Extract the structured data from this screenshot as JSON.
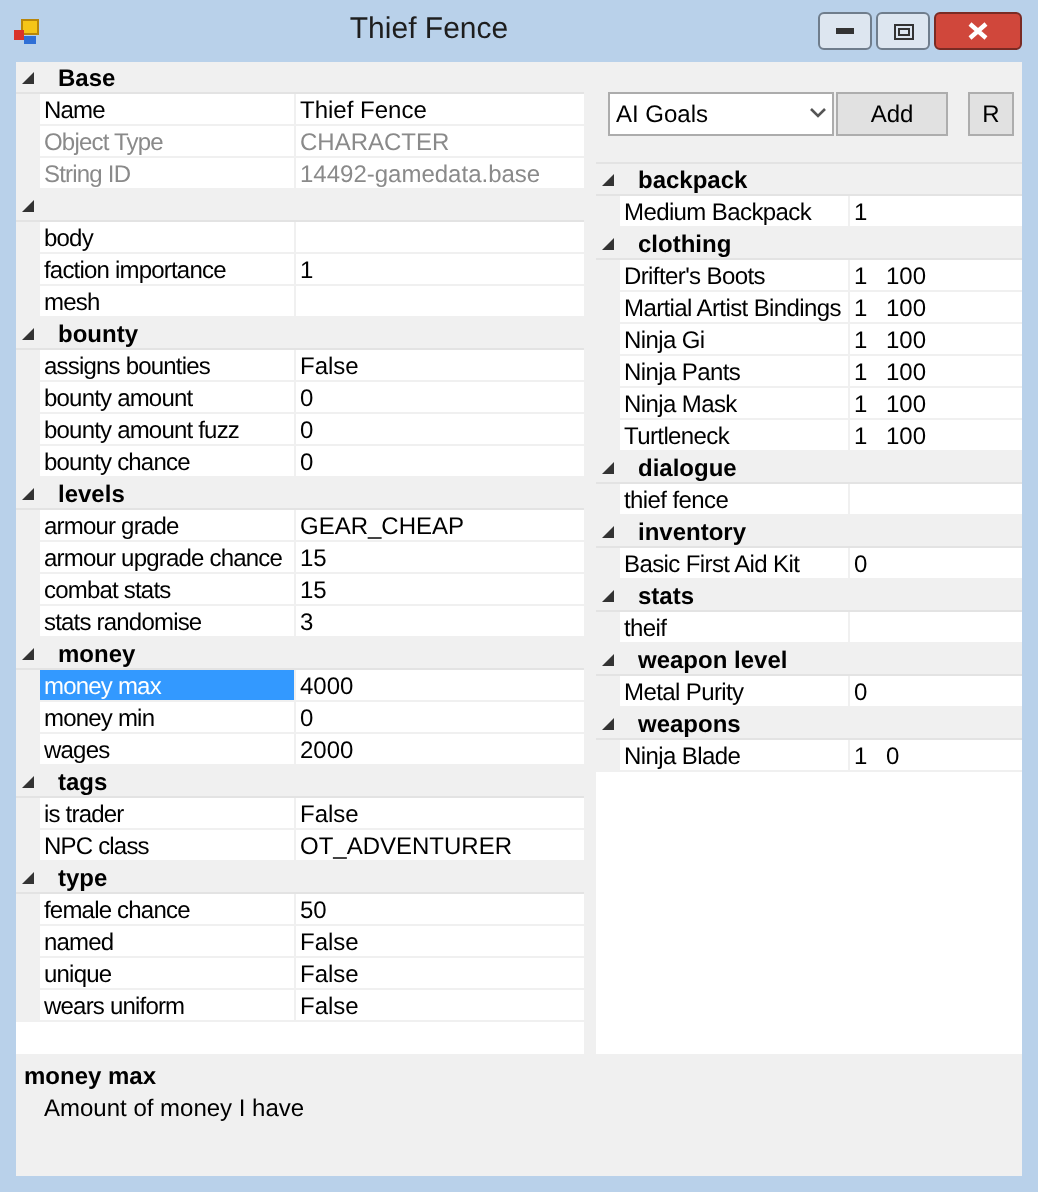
{
  "window": {
    "title": "Thief Fence"
  },
  "properties": [
    {
      "name": "Base",
      "expanded": true,
      "rows": [
        {
          "label": "Name",
          "value": "Thief Fence",
          "disabled": false,
          "selected": false
        },
        {
          "label": "Object Type",
          "value": "CHARACTER",
          "disabled": true,
          "selected": false
        },
        {
          "label": "String ID",
          "value": "14492-gamedata.base",
          "disabled": true,
          "selected": false
        }
      ]
    },
    {
      "expanded": true,
      "rows": [
        {
          "label": "body",
          "disabled": false,
          "selected": false
        },
        {
          "label": "faction importance",
          "value": "1",
          "disabled": false,
          "selected": false
        },
        {
          "label": "mesh",
          "disabled": false,
          "selected": false
        }
      ]
    },
    {
      "name": "bounty",
      "expanded": true,
      "rows": [
        {
          "label": "assigns bounties",
          "value": "False",
          "disabled": false,
          "selected": false
        },
        {
          "label": "bounty amount",
          "value": "0",
          "disabled": false,
          "selected": false
        },
        {
          "label": "bounty amount fuzz",
          "value": "0",
          "disabled": false,
          "selected": false
        },
        {
          "label": "bounty chance",
          "value": "0",
          "disabled": false,
          "selected": false
        }
      ]
    },
    {
      "name": "levels",
      "expanded": true,
      "rows": [
        {
          "label": "armour grade",
          "value": "GEAR_CHEAP",
          "disabled": false,
          "selected": false
        },
        {
          "label": "armour upgrade chance",
          "value": "15",
          "disabled": false,
          "selected": false
        },
        {
          "label": "combat stats",
          "value": "15",
          "disabled": false,
          "selected": false
        },
        {
          "label": "stats randomise",
          "value": "3",
          "disabled": false,
          "selected": false
        }
      ]
    },
    {
      "name": "money",
      "expanded": true,
      "rows": [
        {
          "label": "money max",
          "value": "4000",
          "disabled": false,
          "selected": true
        },
        {
          "label": "money min",
          "value": "0",
          "disabled": false,
          "selected": false
        },
        {
          "label": "wages",
          "value": "2000",
          "disabled": false,
          "selected": false
        }
      ]
    },
    {
      "name": "tags",
      "expanded": true,
      "rows": [
        {
          "label": "is trader",
          "value": "False",
          "disabled": false,
          "selected": false
        },
        {
          "label": "NPC class",
          "value": "OT_ADVENTURER",
          "disabled": false,
          "selected": false
        }
      ]
    },
    {
      "name": "type",
      "expanded": true,
      "rows": [
        {
          "label": "female chance",
          "value": "50",
          "disabled": false,
          "selected": false
        },
        {
          "label": "named",
          "value": "False",
          "disabled": false,
          "selected": false
        },
        {
          "label": "unique",
          "value": "False",
          "disabled": false,
          "selected": false
        },
        {
          "label": "wears uniform",
          "value": "False",
          "disabled": false,
          "selected": false
        }
      ]
    }
  ],
  "help": {
    "title": "money max",
    "text": "Amount of money I have"
  },
  "toolbar": {
    "dropdown": "AI Goals",
    "add": "Add",
    "r": "R"
  },
  "references": [
    {
      "name": "backpack",
      "expanded": true,
      "rows": [
        {
          "name": "Medium Backpack",
          "count": "1"
        }
      ]
    },
    {
      "name": "clothing",
      "expanded": true,
      "rows": [
        {
          "name": "Drifter's Boots",
          "count": "1",
          "extra": "100"
        },
        {
          "name": "Martial Artist Bindings",
          "count": "1",
          "extra": "100"
        },
        {
          "name": "Ninja Gi",
          "count": "1",
          "extra": "100"
        },
        {
          "name": "Ninja Pants",
          "count": "1",
          "extra": "100"
        },
        {
          "name": "Ninja Mask",
          "count": "1",
          "extra": "100"
        },
        {
          "name": "Turtleneck",
          "count": "1",
          "extra": "100"
        }
      ]
    },
    {
      "name": "dialogue",
      "expanded": true,
      "rows": [
        {
          "name": "thief fence"
        }
      ]
    },
    {
      "name": "inventory",
      "expanded": true,
      "rows": [
        {
          "name": "Basic First Aid Kit",
          "count": "0"
        }
      ]
    },
    {
      "name": "stats",
      "expanded": true,
      "rows": [
        {
          "name": "theif"
        }
      ]
    },
    {
      "name": "weapon level",
      "expanded": true,
      "rows": [
        {
          "name": "Metal Purity",
          "count": "0"
        }
      ]
    },
    {
      "name": "weapons",
      "expanded": true,
      "rows": [
        {
          "name": "Ninja Blade",
          "count": "1",
          "extra": "0"
        }
      ]
    }
  ]
}
